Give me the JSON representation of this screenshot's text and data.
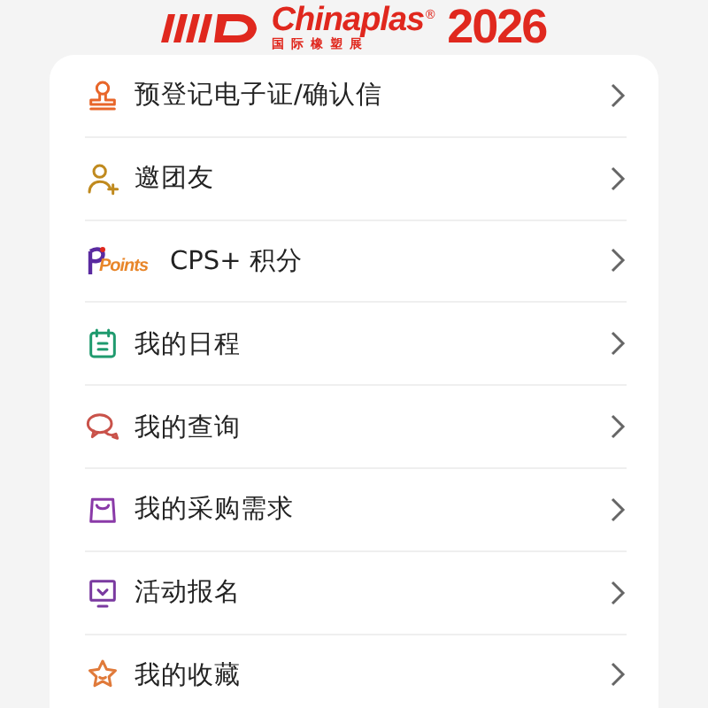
{
  "header": {
    "brand": "Chinaplas",
    "registered": "®",
    "subtitle": "国际橡塑展",
    "year": "2026"
  },
  "menu": [
    {
      "kind": "stamp",
      "label": "预登记电子证/确认信",
      "color": "#e8662a"
    },
    {
      "kind": "person-add",
      "label": "邀团友",
      "color": "#c08a1e"
    },
    {
      "kind": "points",
      "label": "CPS+ 积分",
      "badge": "Points",
      "color": "#5a2aa0"
    },
    {
      "kind": "calendar",
      "label": "我的日程",
      "color": "#1f9a6e"
    },
    {
      "kind": "chat",
      "label": "我的查询",
      "color": "#c9524a"
    },
    {
      "kind": "bag",
      "label": "我的采购需求",
      "color": "#8a3aa8"
    },
    {
      "kind": "monitor",
      "label": "活动报名",
      "color": "#7a3aa0"
    },
    {
      "kind": "star",
      "label": "我的收藏",
      "color": "#e07a3a"
    }
  ]
}
